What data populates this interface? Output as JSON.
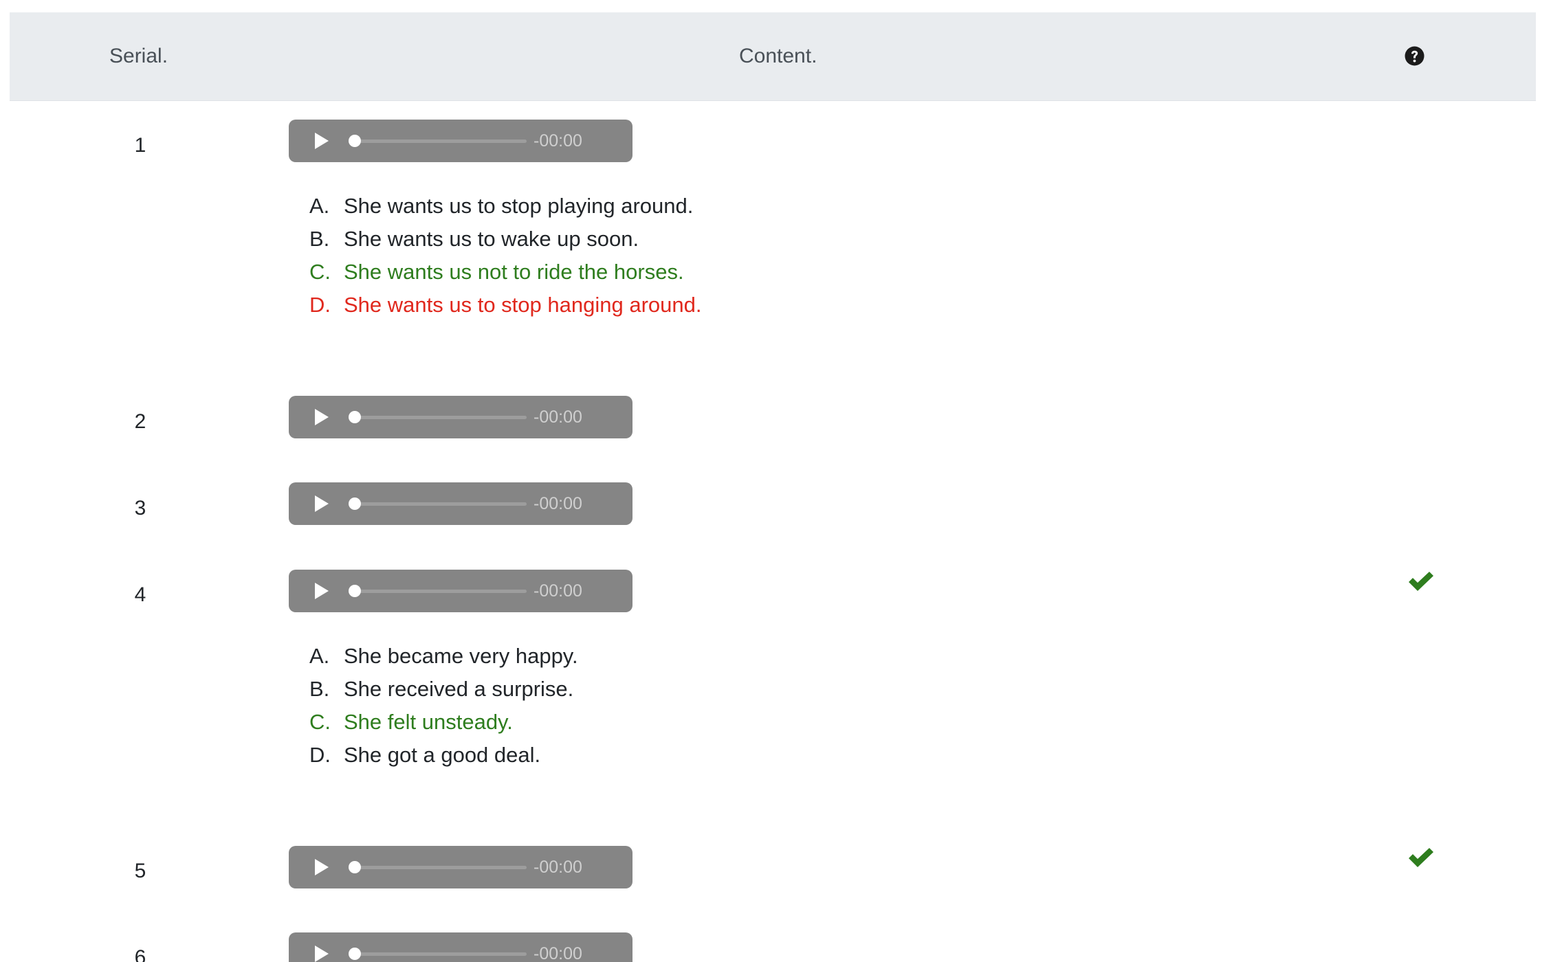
{
  "table": {
    "headers": {
      "serial": "Serial.",
      "content": "Content.",
      "status_icon": "question-circle-icon"
    }
  },
  "player": {
    "time_label": "-00:00",
    "play_icon": "play-icon",
    "progress": 0
  },
  "rows": [
    {
      "number": "1",
      "options": [
        {
          "letter": "A.",
          "text": "She wants us to stop playing around.",
          "state": "normal"
        },
        {
          "letter": "B.",
          "text": "She wants us to wake up soon.",
          "state": "normal"
        },
        {
          "letter": "C.",
          "text": "She wants us not to ride the horses.",
          "state": "correct"
        },
        {
          "letter": "D.",
          "text": "She wants us to stop hanging around.",
          "state": "wrong"
        }
      ],
      "status": ""
    },
    {
      "number": "2",
      "options": [],
      "status": ""
    },
    {
      "number": "3",
      "options": [],
      "status": ""
    },
    {
      "number": "4",
      "options": [
        {
          "letter": "A.",
          "text": "She became very happy.",
          "state": "normal"
        },
        {
          "letter": "B.",
          "text": "She received a surprise.",
          "state": "normal"
        },
        {
          "letter": "C.",
          "text": "She felt unsteady.",
          "state": "correct"
        },
        {
          "letter": "D.",
          "text": "She got a good deal.",
          "state": "normal"
        }
      ],
      "status": "check-icon"
    },
    {
      "number": "5",
      "options": [],
      "status": "check-icon"
    },
    {
      "number": "6",
      "options": [],
      "status": ""
    }
  ],
  "colors": {
    "header_bg": "#e9ecef",
    "player_bg": "#858585",
    "correct": "#2e7d1e",
    "wrong": "#e0281d",
    "check": "#2e7d1e"
  }
}
